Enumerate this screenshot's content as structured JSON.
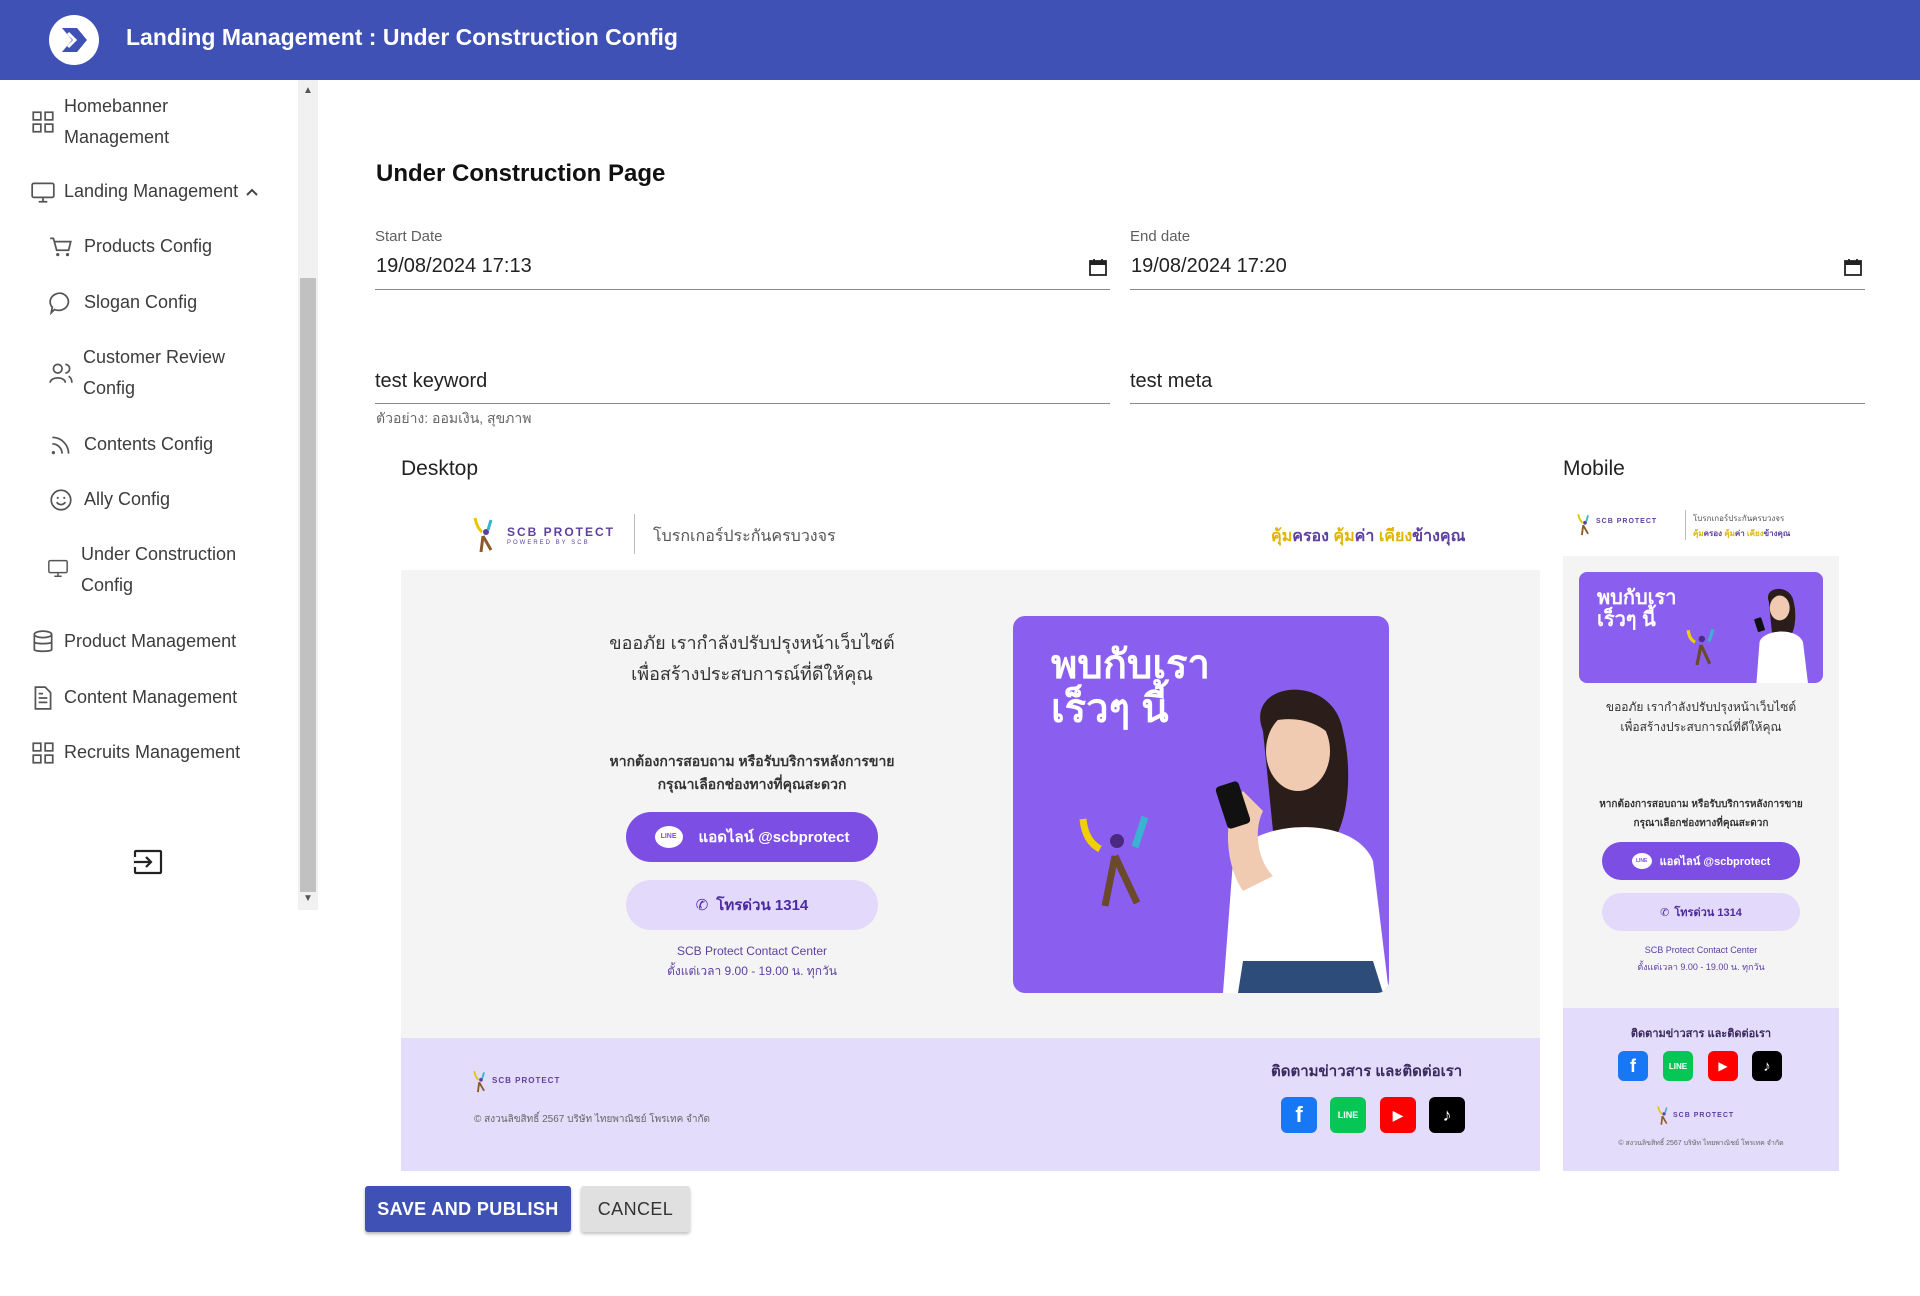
{
  "header": {
    "title": "Landing Management : Under Construction Config"
  },
  "sidebar": {
    "items": [
      {
        "label": "Homebanner\nManagement",
        "icon": "grid-icon"
      },
      {
        "label": "Landing Management",
        "icon": "monitor-icon"
      },
      {
        "label": "Products Config",
        "icon": "cart-icon"
      },
      {
        "label": "Slogan Config",
        "icon": "chat-bubble-icon"
      },
      {
        "label": "Customer Review\nConfig",
        "icon": "users-icon"
      },
      {
        "label": "Contents Config",
        "icon": "rss-icon"
      },
      {
        "label": "Ally Config",
        "icon": "smiley-icon"
      },
      {
        "label": "Under Construction\nConfig",
        "icon": "monitor-icon"
      },
      {
        "label": "Product Management",
        "icon": "database-icon"
      },
      {
        "label": "Content Management",
        "icon": "document-icon"
      },
      {
        "label": "Recruits Management",
        "icon": "grid-icon"
      }
    ]
  },
  "main": {
    "title": "Under Construction Page",
    "start_date": {
      "label": "Start Date",
      "value": "19/08/2024 17:13"
    },
    "end_date": {
      "label": "End date",
      "value": "19/08/2024 17:20"
    },
    "keyword": {
      "value": "test keyword",
      "helper": "ตัวอย่าง: ออมเงิน, สุขภาพ"
    },
    "meta": {
      "value": "test meta"
    },
    "desktop_label": "Desktop",
    "mobile_label": "Mobile"
  },
  "preview": {
    "brand": "SCB PROTECT",
    "brand_sub": "POWERED BY SCB",
    "broker": "โบรกเกอร์ประกันครบวงจร",
    "tagline_1": "คุ้ม",
    "tagline_2": "ครอง ",
    "tagline_3": "คุ้ม",
    "tagline_4": "ค่า ",
    "tagline_5": "เคียง",
    "tagline_6": "ข้างคุณ",
    "sorry_line1": "ขออภัย เรากำลังปรับปรุงหน้าเว็บไซต์",
    "sorry_line2": "เพื่อสร้างประสบการณ์ที่ดีให้คุณ",
    "contact_line1": "หากต้องการสอบถาม หรือรับบริการหลังการขาย",
    "contact_line2": "กรุณาเลือกช่องทางที่คุณสะดวก",
    "line_button": "แอดไลน์ @scbprotect",
    "line_badge": "LINE",
    "hotline_button": "โทรด่วน 1314",
    "center_line1": "SCB Protect Contact Center",
    "center_line2": "ตั้งแต่เวลา 9.00 - 19.00 น. ทุกวัน",
    "promo_line1": "พบกับเรา",
    "promo_line2": "เร็วๆ นี้",
    "follow": "ติดตามข่าวสาร และติดต่อเรา",
    "copyright": "© สงวนลิขสิทธิ์ 2567 บริษัท ไทยพาณิชย์ โพรเทค จำกัด",
    "social": [
      "f",
      "LINE",
      "▶",
      "♪"
    ]
  },
  "actions": {
    "save": "SAVE AND PUBLISH",
    "cancel": "CANCEL"
  },
  "colors": {
    "header": "#3f51b5",
    "accent_purple": "#7c4ee4",
    "footer_bg": "#e3dcfa"
  }
}
